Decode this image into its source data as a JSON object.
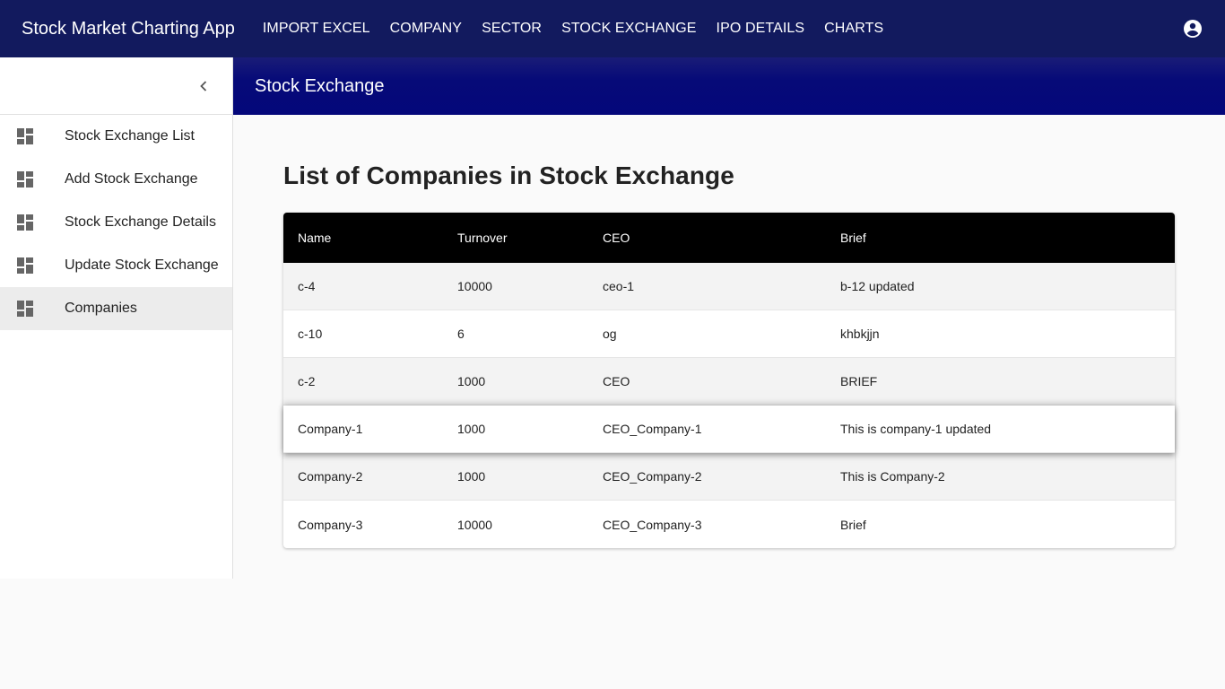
{
  "app_title": "Stock Market Charting App",
  "nav": [
    "IMPORT EXCEL",
    "COMPANY",
    "SECTOR",
    "STOCK EXCHANGE",
    "IPO DETAILS",
    "CHARTS"
  ],
  "subheader": {
    "title": "Stock Exchange"
  },
  "sidebar": {
    "items": [
      {
        "label": "Stock Exchange List",
        "icon": "dashboard-icon"
      },
      {
        "label": "Add Stock Exchange",
        "icon": "dashboard-icon"
      },
      {
        "label": "Stock Exchange Details",
        "icon": "dashboard-icon"
      },
      {
        "label": "Update Stock Exchange",
        "icon": "dashboard-icon"
      },
      {
        "label": "Companies",
        "icon": "dashboard-icon"
      }
    ],
    "active_index": 4
  },
  "main": {
    "title": "List of Companies in Stock Exchange",
    "table": {
      "headers": [
        "Name",
        "Turnover",
        "CEO",
        "Brief"
      ],
      "rows": [
        [
          "c-4",
          "10000",
          "ceo-1",
          "b-12 updated"
        ],
        [
          "c-10",
          "6",
          "og",
          "khbkjjn"
        ],
        [
          "c-2",
          "1000",
          "CEO",
          "BRIEF"
        ],
        [
          "Company-1",
          "1000",
          "CEO_Company-1",
          "This is company-1 updated"
        ],
        [
          "Company-2",
          "1000",
          "CEO_Company-2",
          "This is Company-2"
        ],
        [
          "Company-3",
          "10000",
          "CEO_Company-3",
          "Brief"
        ]
      ]
    }
  },
  "colors": {
    "topbar": "#121a5e",
    "subheader": "#04077a",
    "table_header": "#000000",
    "active_item": "#ececec"
  }
}
